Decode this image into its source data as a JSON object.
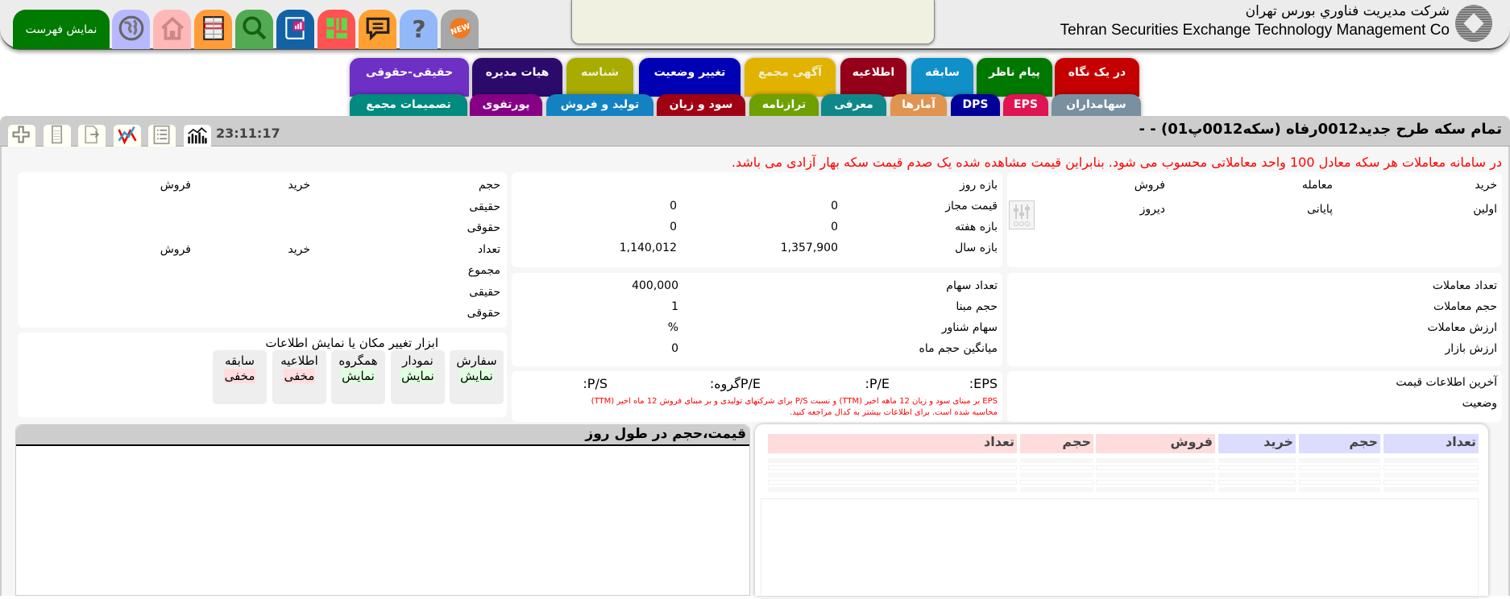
{
  "header": {
    "company_fa": "شرکت مدیریت فناوري بورس تهران",
    "company_en": "Tehran Securities Exchange Technology Management Co",
    "menu_button": "نمایش فهرست",
    "icons": [
      {
        "name": "globe-icon",
        "color": "#b8b8ff"
      },
      {
        "name": "home-icon",
        "color": "#ffb8b8"
      },
      {
        "name": "table-icon",
        "color": "#ff9c38"
      },
      {
        "name": "search-icon",
        "color": "#52aa52"
      },
      {
        "name": "report-book-icon",
        "color": "#1462a6"
      },
      {
        "name": "grid-layout-icon",
        "color": "#ff5252"
      },
      {
        "name": "chat-icon",
        "color": "#ffa030"
      },
      {
        "name": "help-icon",
        "color": "#92b8f8"
      },
      {
        "name": "new-badge-icon",
        "color": "#a8a8a8"
      }
    ]
  },
  "tabs_row1": [
    {
      "label": "حقیقی-حقوقی",
      "color": "#6e2fc4"
    },
    {
      "label": "هیات مدیره",
      "color": "#2c0a6c"
    },
    {
      "label": "شناسه",
      "color": "#a8ac00"
    },
    {
      "label": "تغییر وضعیت",
      "color": "#0000b4"
    },
    {
      "label": "آگهی مجمع",
      "color": "#e2b200"
    },
    {
      "label": "اطلاعیه",
      "color": "#94001a"
    },
    {
      "label": "سابقه",
      "color": "#1090c8"
    },
    {
      "label": "پیام ناظر",
      "color": "#007800"
    },
    {
      "label": "در یک نگاه",
      "color": "#c40000"
    }
  ],
  "tabs_row2": [
    {
      "label": "تصمیمات مجمع",
      "color": "#008a80"
    },
    {
      "label": "پورتفوی",
      "color": "#860086"
    },
    {
      "label": "تولید و فروش",
      "color": "#1282c2"
    },
    {
      "label": "سود و زیان",
      "color": "#a00014"
    },
    {
      "label": "ترازنامه",
      "color": "#6ea000"
    },
    {
      "label": "معرفی",
      "color": "#10888a"
    },
    {
      "label": "آمارها",
      "color": "#e09450"
    },
    {
      "label": "DPS",
      "color": "#000098"
    },
    {
      "label": "EPS",
      "color": "#e01452"
    },
    {
      "label": "سهامداران",
      "color": "#7890a0"
    }
  ],
  "titlebar": {
    "title": "تمام سکه طرح جدید0012رفاه (سکه0012پ01) - -",
    "time": "23:11:17",
    "tools": [
      "add-icon",
      "calculator-icon",
      "export-icon",
      "chart-compare-icon",
      "list-icon",
      "market-chart-icon"
    ]
  },
  "notice": "در سامانه معاملات هر سکه معادل 100 واحد معاملاتی محسوب می شود. بنابراین قیمت مشاهده شده یک صدم قیمت سکه بهار آزادی می باشد.",
  "price_panel": {
    "headers": [
      "خرید",
      "معامله",
      "فروش"
    ],
    "row": [
      "اولین",
      "پایانی",
      "دیروز"
    ]
  },
  "range_panel": {
    "rows": [
      {
        "label": "بازه روز",
        "v1": "",
        "v2": ""
      },
      {
        "label": "قیمت مجاز",
        "v1": "0",
        "v2": "0"
      },
      {
        "label": "بازه هفته",
        "v1": "0",
        "v2": "0"
      },
      {
        "label": "بازه سال",
        "v1": "1,357,900",
        "v2": "1,140,012"
      }
    ]
  },
  "client_panel": {
    "rows": [
      {
        "label": "حجم",
        "buy": "خرید",
        "sell": "فروش"
      },
      {
        "label": "حقیقی",
        "buy": "",
        "sell": ""
      },
      {
        "label": "حقوقی",
        "buy": "",
        "sell": ""
      },
      {
        "label": "تعداد",
        "buy": "خرید",
        "sell": "فروش"
      },
      {
        "label": "مجموع",
        "buy": "",
        "sell": ""
      },
      {
        "label": "حقیقی",
        "buy": "",
        "sell": ""
      },
      {
        "label": "حقوقی",
        "buy": "",
        "sell": ""
      }
    ]
  },
  "trade_panel": {
    "rows": [
      "تعداد معاملات",
      "حجم معاملات",
      "ارزش معاملات",
      "ارزش بازار"
    ]
  },
  "share_panel": {
    "rows": [
      {
        "label": "تعداد سهام",
        "value": "400,000"
      },
      {
        "label": "حجم مبنا",
        "value": "1"
      },
      {
        "label": "سهام شناور",
        "value": "%"
      },
      {
        "label": "میانگین حجم ماه",
        "value": "0"
      }
    ]
  },
  "status_panel": {
    "rows": [
      "آخرین اطلاعات قیمت",
      "وضعیت"
    ]
  },
  "ratio_panel": {
    "eps": "EPS:",
    "pe": "P/E:",
    "group_pe": "P/Eگروه:",
    "ps": "P/S:",
    "note_line1": "EPS بر مبنای سود و زیان 12 ماهه اخیر (TTM) و نسبت P/S برای شرکتهای تولیدی و بر مبنای فروش 12 ماه اخیر (TTM)",
    "note_line2": "محاسبه شده است. برای اطلاعات بیشتر به کدال مراجعه کنید."
  },
  "layout_tools": {
    "title": "ابزار تغییر مکان یا نمایش اطلاعات",
    "items": [
      {
        "label": "سفارش",
        "state": "نمایش",
        "shown": true
      },
      {
        "label": "نمودار",
        "state": "نمایش",
        "shown": true
      },
      {
        "label": "همگروه",
        "state": "نمایش",
        "shown": true
      },
      {
        "label": "اطلاعیه",
        "state": "مخفی",
        "shown": false
      },
      {
        "label": "سابقه",
        "state": "مخفی",
        "shown": false
      }
    ]
  },
  "intraday_chart": {
    "title": "قیمت،حجم در طول روز"
  },
  "orderbook": {
    "headers": [
      {
        "label": "تعداد",
        "side": "buy"
      },
      {
        "label": "حجم",
        "side": "buy"
      },
      {
        "label": "خرید",
        "side": "buy"
      },
      {
        "label": "فروش",
        "side": "sell"
      },
      {
        "label": "حجم",
        "side": "sell"
      },
      {
        "label": "تعداد",
        "side": "sell"
      }
    ],
    "buy_color": "#dcdcff",
    "sell_color": "#ffdcdc"
  }
}
